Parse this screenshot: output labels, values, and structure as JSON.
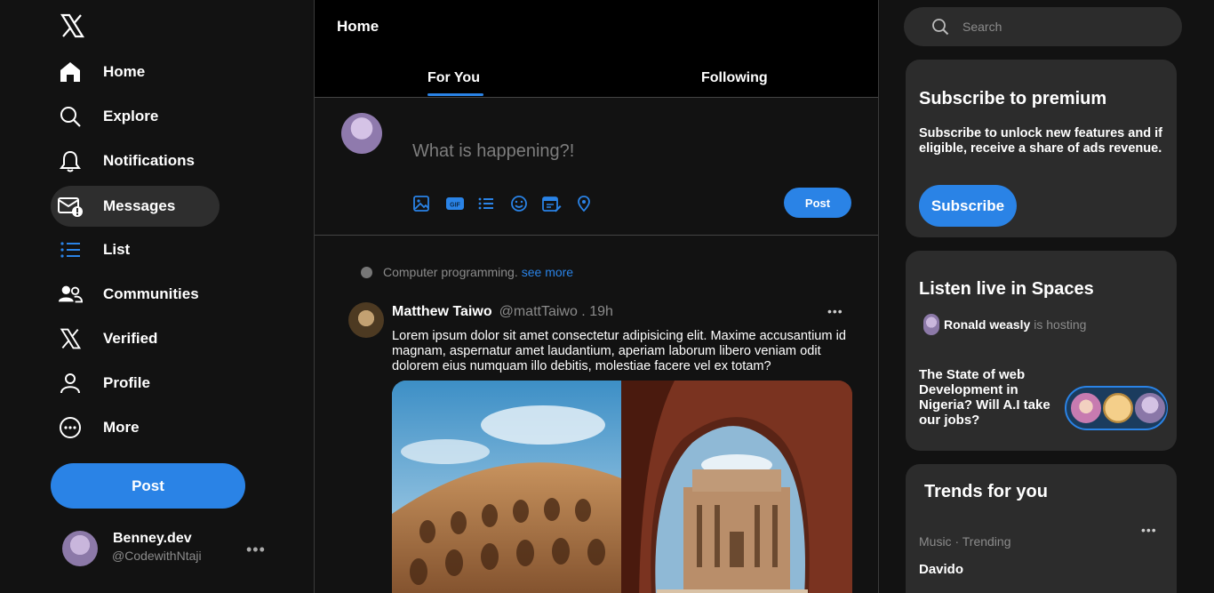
{
  "sidebar": {
    "logo_icon": "x-logo-icon",
    "items": [
      {
        "label": "Home",
        "icon": "home-icon"
      },
      {
        "label": "Explore",
        "icon": "search-icon"
      },
      {
        "label": "Notifications",
        "icon": "bell-icon"
      },
      {
        "label": "Messages",
        "icon": "mail-icon",
        "active": true
      },
      {
        "label": "List",
        "icon": "list-icon"
      },
      {
        "label": "Communities",
        "icon": "people-icon"
      },
      {
        "label": "Verified",
        "icon": "x-logo-icon"
      },
      {
        "label": "Profile",
        "icon": "person-icon"
      },
      {
        "label": "More",
        "icon": "more-circle-icon"
      }
    ],
    "post_label": "Post",
    "account": {
      "name": "Benney.dev",
      "handle": "@CodewithNtaji",
      "more": "•••"
    }
  },
  "main": {
    "title": "Home",
    "tabs": [
      {
        "label": "For You",
        "active": true
      },
      {
        "label": "Following",
        "active": false
      }
    ],
    "composer": {
      "placeholder": "What is happening?!",
      "tools": [
        "image-icon",
        "gif-icon",
        "list-icon",
        "emoji-icon",
        "schedule-icon",
        "location-icon"
      ],
      "post_label": "Post"
    },
    "feed": {
      "topic": "Computer programming.",
      "topic_link": "see more",
      "tweet": {
        "name": "Matthew Taiwo",
        "handle": "@mattTaiwo . 19h",
        "more": "•••",
        "text": "Lorem ipsum dolor sit amet consectetur adipisicing elit. Maxime accusantium id magnam, aspernatur amet laudantium, aperiam laborum libero veniam odit dolorem eius numquam illo debitis, molestiae facere vel ex totam?"
      }
    }
  },
  "right": {
    "search": {
      "placeholder": "Search"
    },
    "premium": {
      "title": "Subscribe to premium",
      "text": "Subscribe to unlock new features and if eligible, receive a share of ads revenue.",
      "button": "Subscribe"
    },
    "spaces": {
      "title": "Listen live in Spaces",
      "host_name": "Ronald weasly",
      "host_status": "is hosting",
      "space_title": "The State of web Development in Nigeria? Will A.I take our jobs?"
    },
    "trends": {
      "title": "Trends for you",
      "meta": "Music · Trending",
      "name": "Davido",
      "more": "•••"
    }
  },
  "colors": {
    "accent": "#2a83e6",
    "bg": "#121212",
    "card": "#2c2c2c"
  }
}
